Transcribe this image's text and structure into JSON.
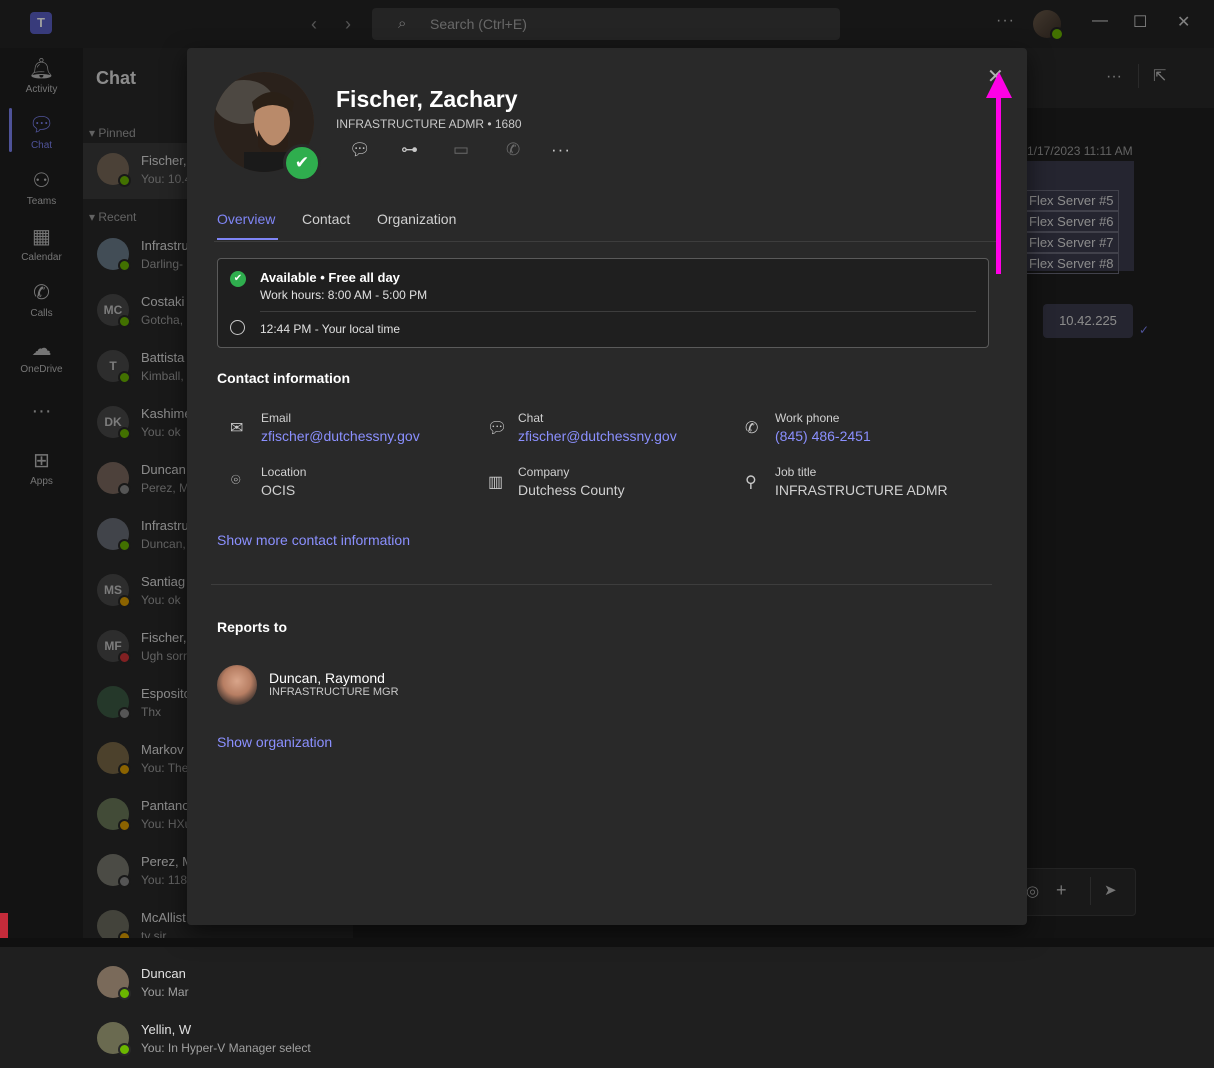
{
  "titlebar": {
    "logo": "T",
    "search_placeholder": "Search (Ctrl+E)",
    "icons": [
      "back-arrow",
      "forward-arrow",
      "search-icon",
      "more-icon",
      "minimize-icon",
      "maximize-icon",
      "close-icon"
    ]
  },
  "rail": {
    "items": [
      {
        "label": "Activity",
        "icon": "bell-icon"
      },
      {
        "label": "Chat",
        "icon": "chat-icon"
      },
      {
        "label": "Teams",
        "icon": "teams-icon"
      },
      {
        "label": "Calendar",
        "icon": "calendar-icon"
      },
      {
        "label": "Calls",
        "icon": "phone-icon"
      },
      {
        "label": "OneDrive",
        "icon": "cloud-icon"
      },
      {
        "label": "Apps",
        "icon": "add-app-icon"
      }
    ],
    "active_color": "#7f85f5"
  },
  "chatlist": {
    "title": "Chat",
    "pinned_label": "Pinned",
    "recent_label": "Recent",
    "pinned": [
      {
        "name": "Fischer,",
        "preview": "You: 10.4"
      }
    ],
    "recent": [
      {
        "initials": "",
        "name": "Infrastru",
        "preview": "Darling-"
      },
      {
        "initials": "MC",
        "name": "Costaki",
        "preview": "Gotcha, I"
      },
      {
        "initials": "T",
        "name": "Battista",
        "preview": "Kimball,"
      },
      {
        "initials": "DK",
        "name": "Kashime",
        "preview": "You: ok"
      },
      {
        "initials": "",
        "name": "Duncan",
        "preview": "Perez, M"
      },
      {
        "initials": "",
        "name": "Infrastru",
        "preview": "Duncan,"
      },
      {
        "initials": "MS",
        "name": "Santiag",
        "preview": "You: ok"
      },
      {
        "initials": "MF",
        "name": "Fischer,",
        "preview": "Ugh sorr"
      },
      {
        "initials": "",
        "name": "Esposito",
        "preview": "Thx"
      },
      {
        "initials": "",
        "name": "Markov",
        "preview": "You: The"
      },
      {
        "initials": "",
        "name": "Pantano",
        "preview": "You: HXu"
      },
      {
        "initials": "",
        "name": "Perez, M",
        "preview": "You: 118"
      },
      {
        "initials": "",
        "name": "McAllist",
        "preview": "ty sir"
      },
      {
        "initials": "",
        "name": "Duncan",
        "preview": "You: Mar"
      },
      {
        "initials": "",
        "name": "Yellin, W",
        "preview": "You: In Hyper-V Manager select"
      }
    ]
  },
  "conversation": {
    "date": "1/17/2023 11:11 AM",
    "flex_lines": [
      "Flex Server #5",
      "Flex Server #6",
      "Flex Server #7",
      "Flex Server #8"
    ],
    "ip_message": "10.42.225"
  },
  "profile": {
    "name": "Fischer, Zachary",
    "subtitle": "INFRASTRUCTURE ADMR • 1680",
    "status_color": "#2fae4e",
    "tabs": [
      "Overview",
      "Contact",
      "Organization"
    ],
    "availability": {
      "title": "Available • Free all day",
      "hours": "Work hours: 8:00 AM - 5:00 PM",
      "local_time": "12:44 PM - Your local time"
    },
    "contact_heading": "Contact information",
    "contact": {
      "email_label": "Email",
      "email_value": "zfischer@dutchessny.gov",
      "chat_label": "Chat",
      "chat_value": "zfischer@dutchessny.gov",
      "phone_label": "Work phone",
      "phone_value": "(845) 486-2451",
      "location_label": "Location",
      "location_value": "OCIS",
      "company_label": "Company",
      "company_value": "Dutchess County",
      "job_label": "Job title",
      "job_value": "INFRASTRUCTURE ADMR"
    },
    "more_contact": "Show more contact information",
    "reports_heading": "Reports to",
    "manager": {
      "name": "Duncan, Raymond",
      "title": "INFRASTRUCTURE MGR"
    },
    "show_org": "Show organization"
  },
  "colors": {
    "accent": "#7f85f5",
    "link": "#8b90ff",
    "annotation": "#ff00e6",
    "available": "#2fae4e"
  }
}
